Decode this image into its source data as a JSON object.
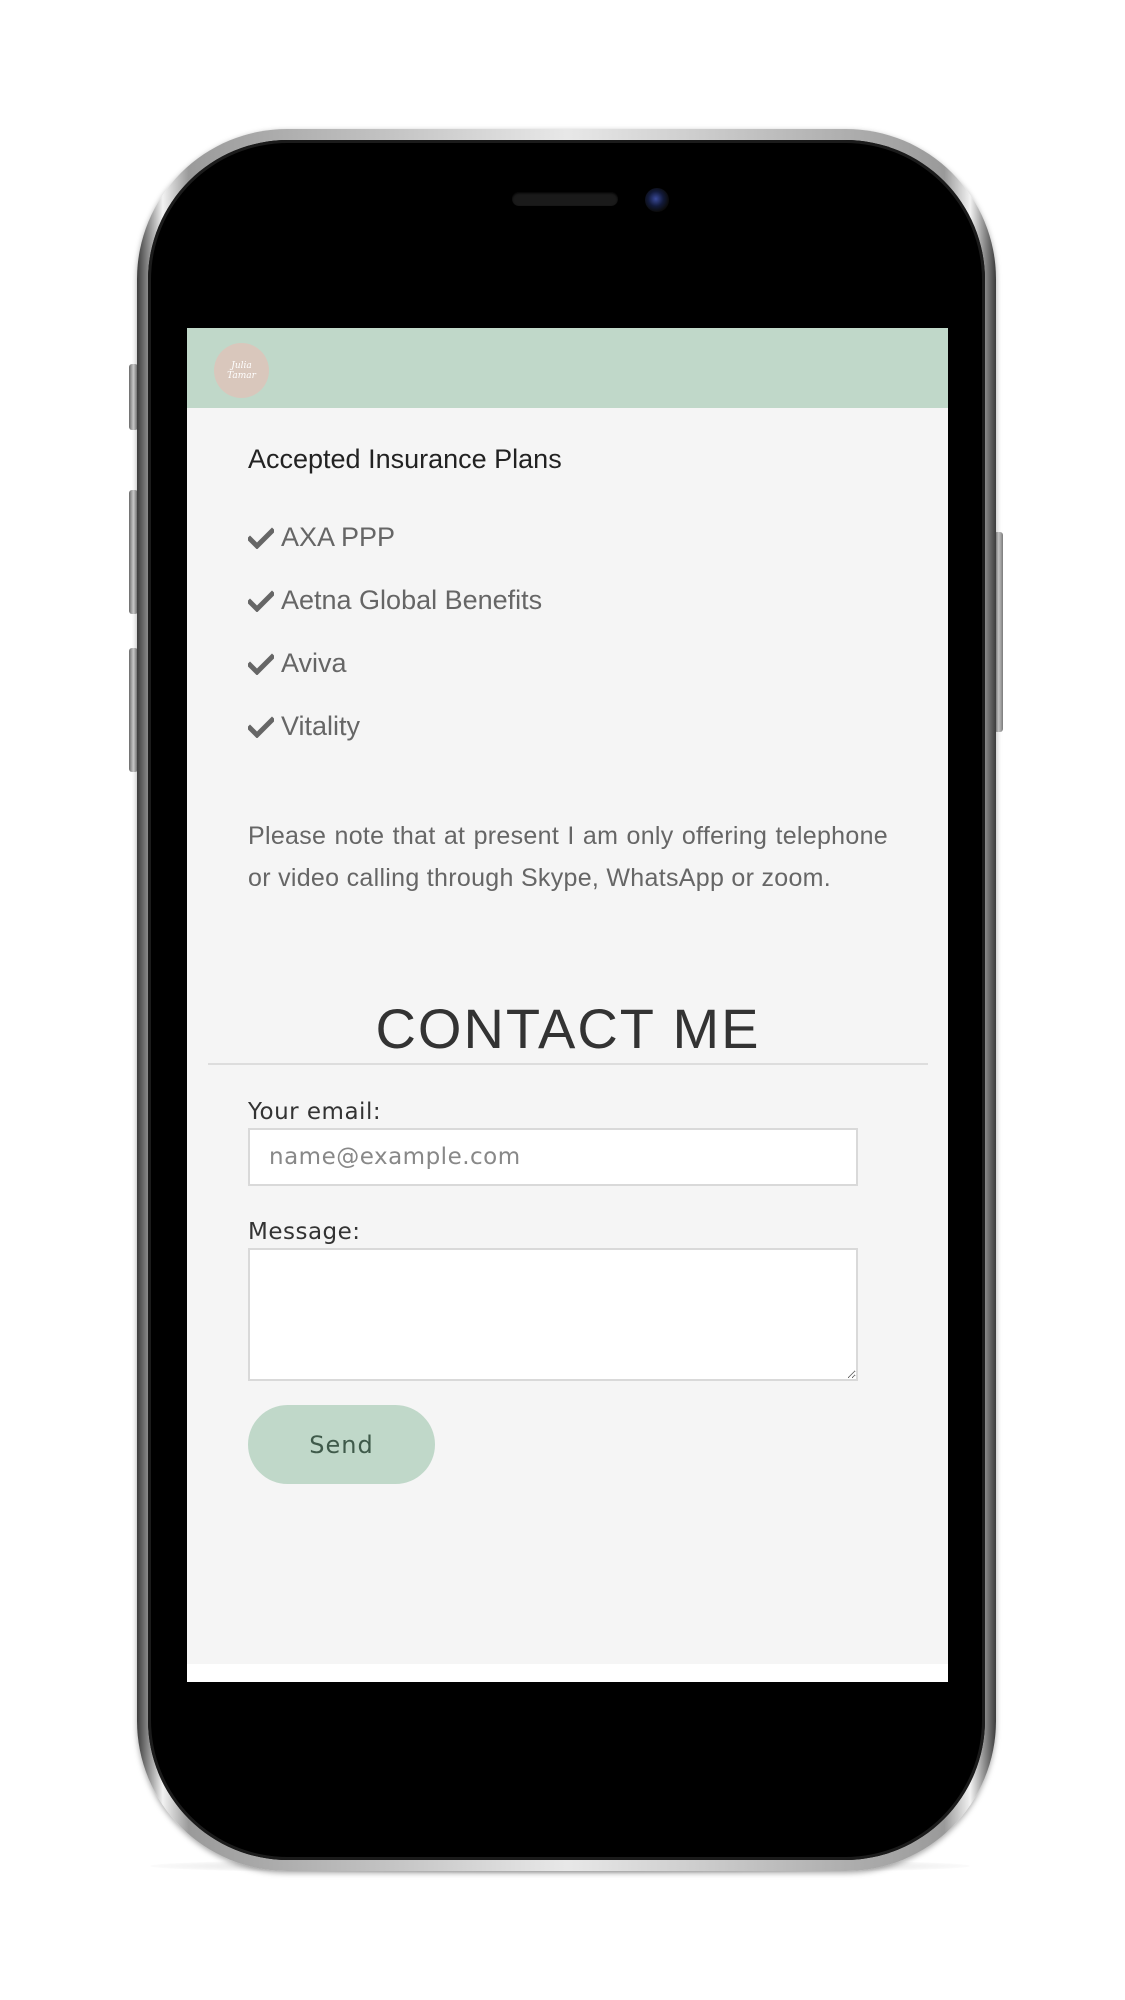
{
  "header": {
    "logo_line1": "Julia",
    "logo_line2": "Tamar"
  },
  "insurance": {
    "title": "Accepted Insurance Plans",
    "plans": [
      {
        "label": "AXA PPP"
      },
      {
        "label": "Aetna Global Benefits"
      },
      {
        "label": "Aviva"
      },
      {
        "label": "Vitality"
      }
    ],
    "note": "Please note that at present I am only offering telephone or video calling through Skype, WhatsApp or zoom."
  },
  "contact": {
    "title": "CONTACT ME",
    "email_label": "Your email:",
    "email_placeholder": "name@example.com",
    "email_value": "",
    "message_label": "Message:",
    "message_value": "",
    "send_label": "Send"
  },
  "icons": {
    "check": "check-icon"
  },
  "colors": {
    "accent": "#c0d8c9",
    "logo_bg": "#d9c7bc",
    "screen_bg": "#f5f5f5"
  }
}
